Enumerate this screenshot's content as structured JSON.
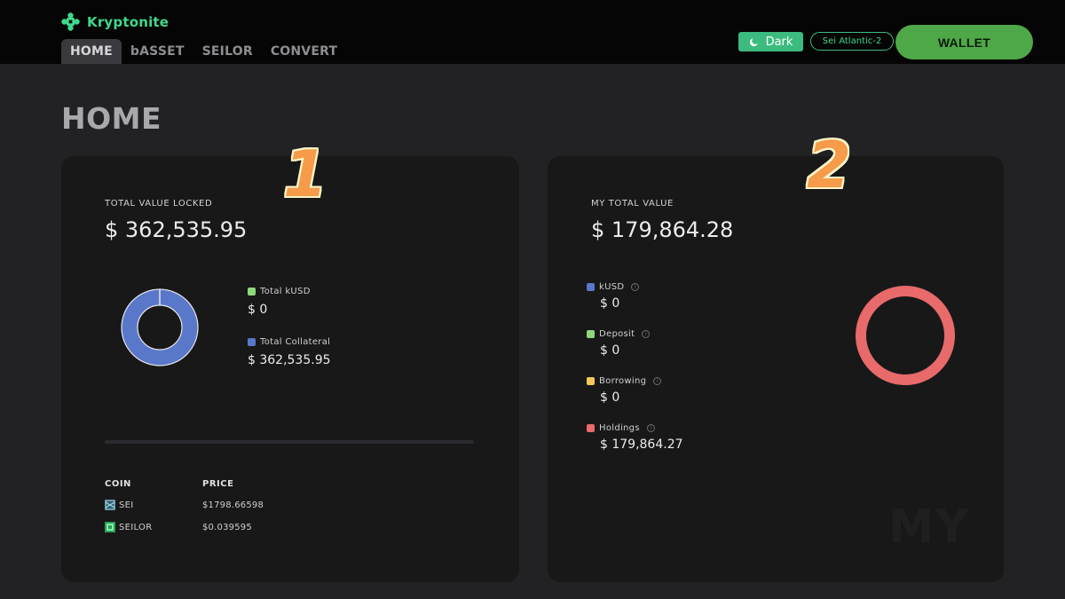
{
  "app": {
    "name": "Kryptonite",
    "brand_color": "#3fd88c"
  },
  "nav": {
    "tabs": [
      {
        "label": "HOME",
        "active": true
      },
      {
        "label": "bASSET",
        "active": false
      },
      {
        "label": "SEILOR",
        "active": false
      },
      {
        "label": "CONVERT",
        "active": false
      }
    ]
  },
  "header": {
    "theme_label": "Dark",
    "network_label": "Sei Atlantic-2",
    "wallet_label": "WALLET"
  },
  "page": {
    "title": "HOME"
  },
  "overlays": {
    "badge_1": "1",
    "badge_2": "2"
  },
  "tvl_card": {
    "label": "TOTAL VALUE LOCKED",
    "value": "$ 362,535.95",
    "legend": [
      {
        "label": "Total kUSD",
        "value": "$ 0",
        "color": "#8fd77c"
      },
      {
        "label": "Total Collateral",
        "value": "$ 362,535.95",
        "color": "#5a78c9"
      }
    ],
    "table": {
      "headers": [
        "COIN",
        "PRICE"
      ],
      "rows": [
        {
          "coin": "SEI",
          "price": "$1798.66598",
          "icon": "sei-coin-icon"
        },
        {
          "coin": "SEILOR",
          "price": "$0.039595",
          "icon": "seilor-coin-icon"
        }
      ]
    }
  },
  "my_card": {
    "label": "MY TOTAL VALUE",
    "value": "$ 179,864.28",
    "legend": [
      {
        "label": "kUSD",
        "value": "$ 0",
        "color": "#5a78c9"
      },
      {
        "label": "Deposit",
        "value": "$ 0",
        "color": "#8fd77c"
      },
      {
        "label": "Borrowing",
        "value": "$ 0",
        "color": "#f4c95a"
      },
      {
        "label": "Holdings",
        "value": "$ 179,864.27",
        "color": "#e86a6a"
      }
    ],
    "watermark": "MY"
  },
  "chart_data": [
    {
      "type": "pie",
      "categories": [
        "Total kUSD",
        "Total Collateral"
      ],
      "values": [
        0,
        362535.95
      ],
      "colors": [
        "#8fd77c",
        "#5a78c9"
      ]
    },
    {
      "type": "pie",
      "categories": [
        "kUSD",
        "Deposit",
        "Borrowing",
        "Holdings"
      ],
      "values": [
        0,
        0,
        0,
        179864.27
      ],
      "colors": [
        "#5a78c9",
        "#8fd77c",
        "#f4c95a",
        "#e86a6a"
      ]
    }
  ]
}
